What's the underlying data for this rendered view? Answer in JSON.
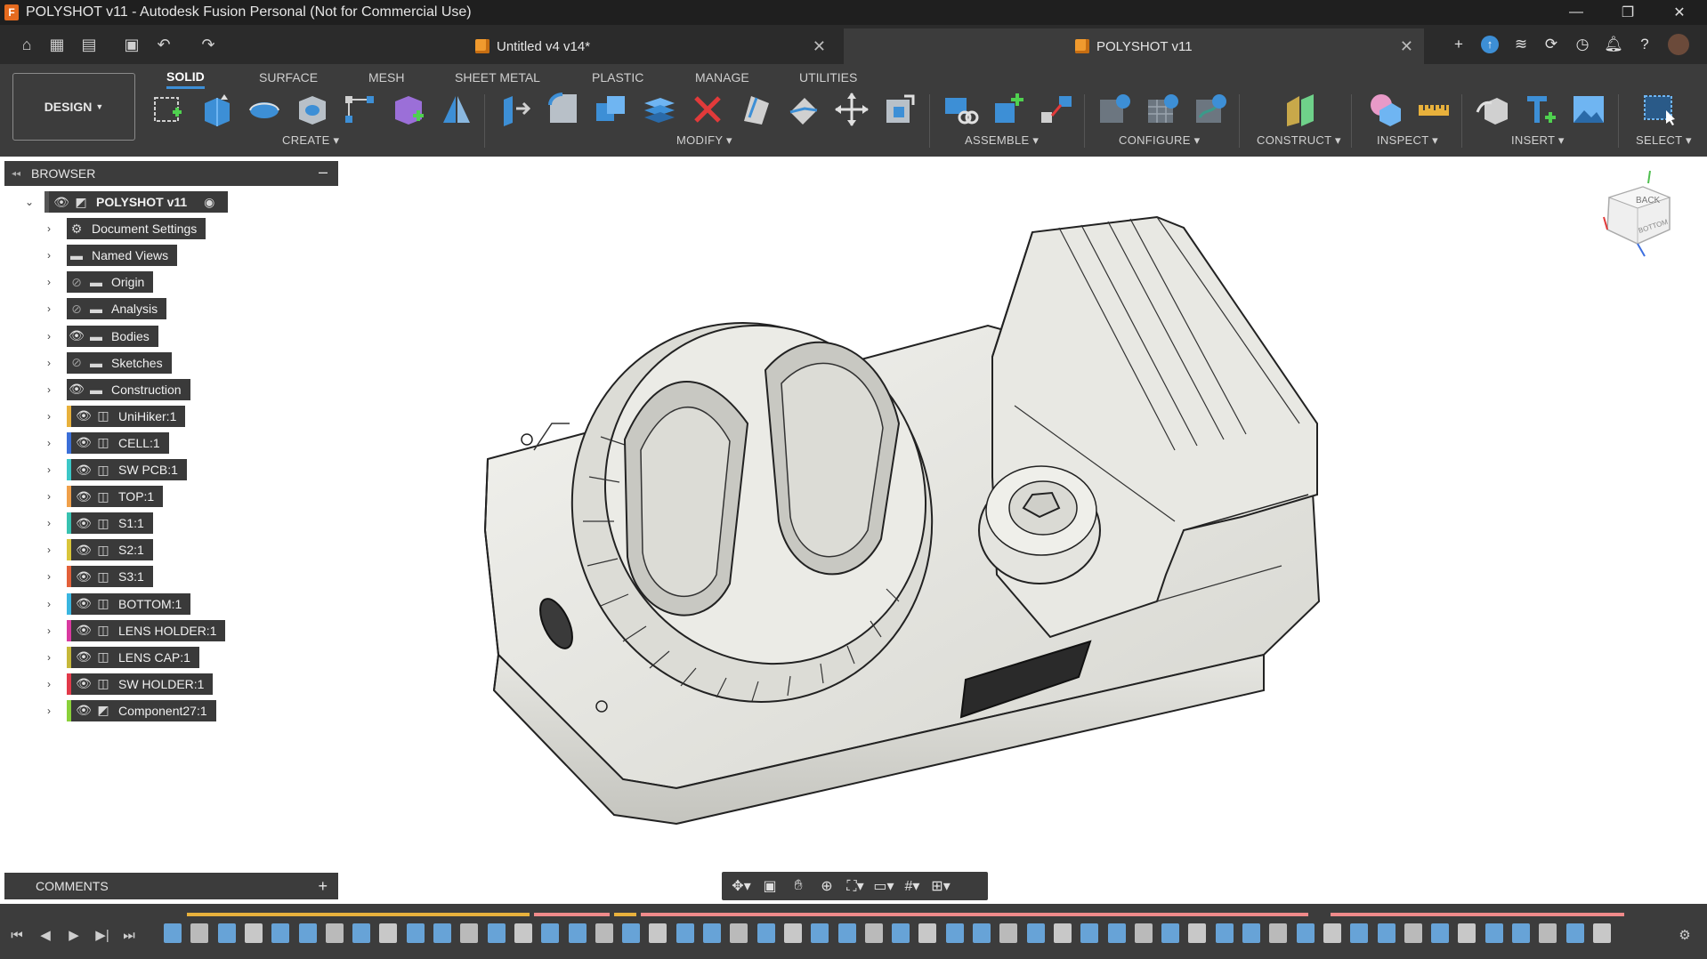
{
  "window": {
    "title": "POLYSHOT v11 - Autodesk Fusion Personal (Not for Commercial Use)",
    "app_icon": "F",
    "controls": [
      "minimize-icon",
      "restore-icon",
      "close-icon"
    ]
  },
  "tabs": [
    {
      "label": "Untitled v4 v14*",
      "active": false
    },
    {
      "label": "POLYSHOT v11",
      "active": true
    }
  ],
  "ribbon": {
    "workspace_label": "DESIGN",
    "tabs": [
      "SOLID",
      "SURFACE",
      "MESH",
      "SHEET METAL",
      "PLASTIC",
      "MANAGE",
      "UTILITIES"
    ],
    "active_tab": "SOLID",
    "groups": [
      {
        "label": "CREATE"
      },
      {
        "label": "MODIFY"
      },
      {
        "label": "ASSEMBLE"
      },
      {
        "label": "CONFIGURE"
      },
      {
        "label": "CONSTRUCT"
      },
      {
        "label": "INSPECT"
      },
      {
        "label": "INSERT"
      },
      {
        "label": "SELECT"
      }
    ],
    "accent_color": "#3d8fd6"
  },
  "browser": {
    "header": "BROWSER",
    "root": "POLYSHOT v11",
    "items": [
      {
        "label": "Document Settings",
        "kind": "settings",
        "visible_icon": "none",
        "color": ""
      },
      {
        "label": "Named Views",
        "kind": "folder",
        "visible_icon": "none",
        "color": ""
      },
      {
        "label": "Origin",
        "kind": "folder",
        "visible_icon": "hidden",
        "color": ""
      },
      {
        "label": "Analysis",
        "kind": "folder",
        "visible_icon": "hidden",
        "color": ""
      },
      {
        "label": "Bodies",
        "kind": "folder",
        "visible_icon": "visible",
        "color": ""
      },
      {
        "label": "Sketches",
        "kind": "folder",
        "visible_icon": "hidden",
        "color": ""
      },
      {
        "label": "Construction",
        "kind": "folder",
        "visible_icon": "visible",
        "color": ""
      },
      {
        "label": "UniHiker:1",
        "kind": "component",
        "visible_icon": "visible",
        "color": "#e8b13c"
      },
      {
        "label": "CELL:1",
        "kind": "component",
        "visible_icon": "visible",
        "color": "#3b6fd8"
      },
      {
        "label": "SW PCB:1",
        "kind": "component",
        "visible_icon": "visible",
        "color": "#3cc7c7"
      },
      {
        "label": "TOP:1",
        "kind": "component",
        "visible_icon": "visible",
        "color": "#f0a04a"
      },
      {
        "label": "S1:1",
        "kind": "component",
        "visible_icon": "visible",
        "color": "#38c2b0"
      },
      {
        "label": "S2:1",
        "kind": "component",
        "visible_icon": "visible",
        "color": "#d9c53a"
      },
      {
        "label": "S3:1",
        "kind": "component",
        "visible_icon": "visible",
        "color": "#e3603a"
      },
      {
        "label": "BOTTOM:1",
        "kind": "component",
        "visible_icon": "visible",
        "color": "#3ab6e0"
      },
      {
        "label": "LENS HOLDER:1",
        "kind": "component",
        "visible_icon": "visible",
        "color": "#d93aa0"
      },
      {
        "label": "LENS CAP:1",
        "kind": "component",
        "visible_icon": "visible",
        "color": "#c6b83a"
      },
      {
        "label": "SW HOLDER:1",
        "kind": "component",
        "visible_icon": "visible",
        "color": "#e23a4a"
      },
      {
        "label": "Component27:1",
        "kind": "assembly",
        "visible_icon": "visible",
        "color": "#8ad13a"
      }
    ]
  },
  "comments": {
    "label": "COMMENTS"
  },
  "viewcube": {
    "face_top": "BACK",
    "face_bottom": "BOTTOM"
  },
  "navbar": {
    "icons": [
      "orbit-icon",
      "look-at-icon",
      "pan-icon",
      "zoom-icon",
      "fit-icon",
      "display-icon",
      "grid-icon",
      "viewports-icon"
    ]
  }
}
